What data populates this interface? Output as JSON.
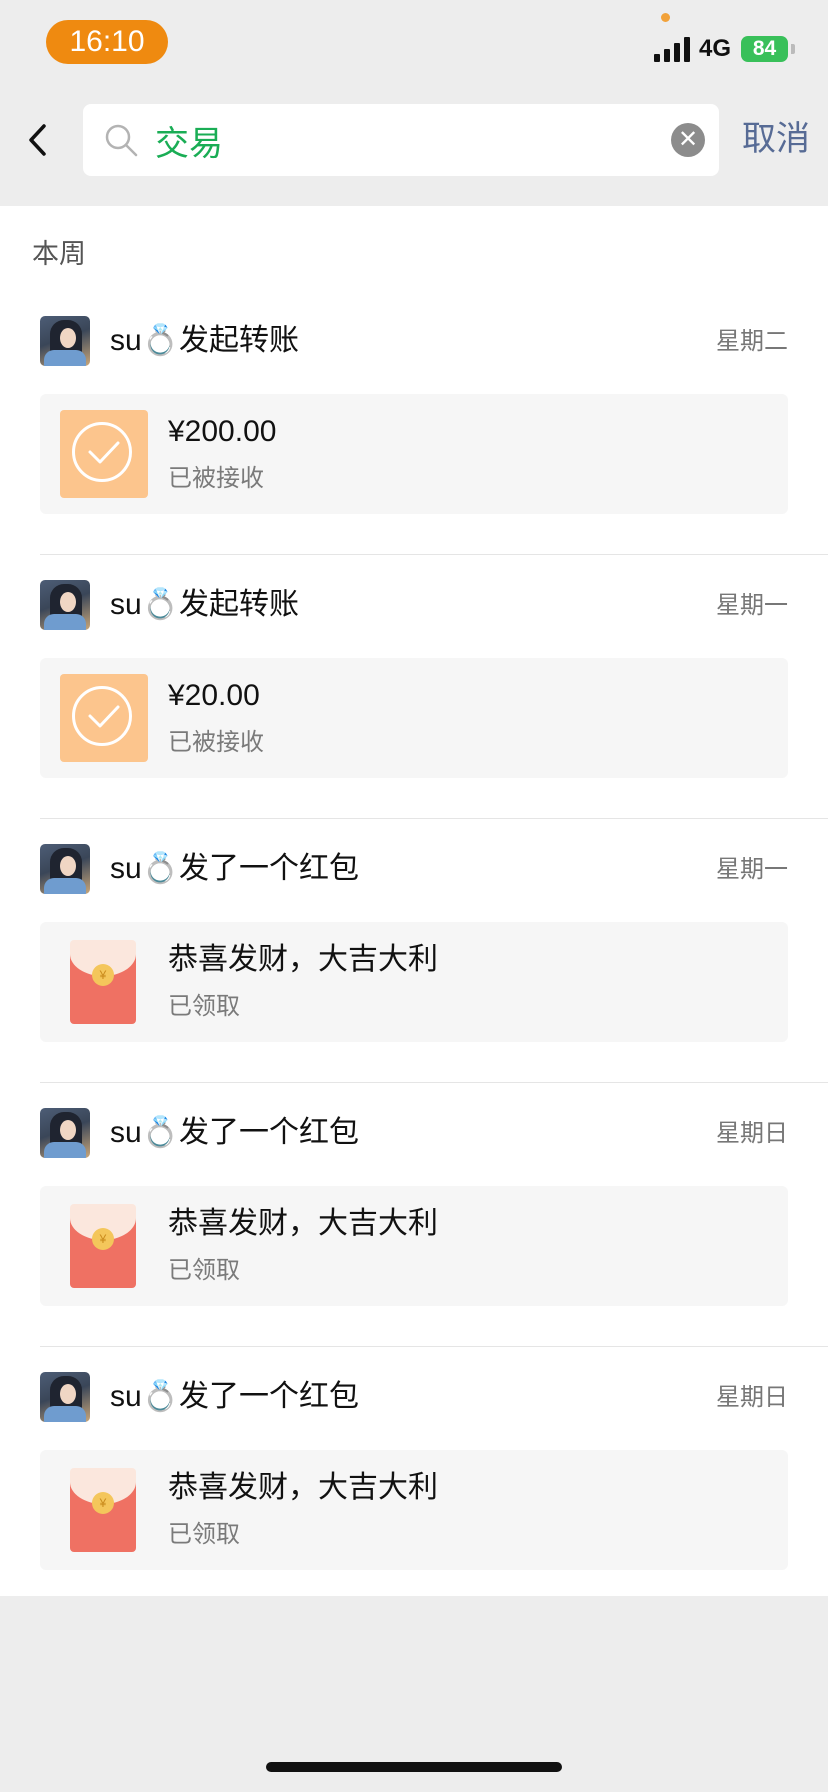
{
  "status_bar": {
    "time": "16:10",
    "network": "4G",
    "battery": "84"
  },
  "search": {
    "value": "交易",
    "cancel_label": "取消"
  },
  "section": {
    "title": "本周"
  },
  "entries": [
    {
      "name": "su💍发起转账",
      "date": "星期二",
      "type": "transfer",
      "main": "¥200.00",
      "status": "已被接收"
    },
    {
      "name": "su💍发起转账",
      "date": "星期一",
      "type": "transfer",
      "main": "¥20.00",
      "status": "已被接收"
    },
    {
      "name": "su💍发了一个红包",
      "date": "星期一",
      "type": "red-packet",
      "main": "恭喜发财，大吉大利",
      "status": "已领取"
    },
    {
      "name": "su💍发了一个红包",
      "date": "星期日",
      "type": "red-packet",
      "main": "恭喜发财，大吉大利",
      "status": "已领取"
    },
    {
      "name": "su💍发了一个红包",
      "date": "星期日",
      "type": "red-packet",
      "main": "恭喜发财，大吉大利",
      "status": "已领取"
    }
  ],
  "colors": {
    "time_pill": "#ef8a10",
    "search_text": "#1aad55",
    "cancel": "#576b95",
    "transfer_icon": "#fcc58d",
    "red_packet": "#ef7163"
  },
  "icons": {
    "back": "chevron-left-icon",
    "search": "search-icon",
    "clear": "clear-icon",
    "transfer": "check-circle-icon",
    "red_packet": "red-packet-icon"
  }
}
